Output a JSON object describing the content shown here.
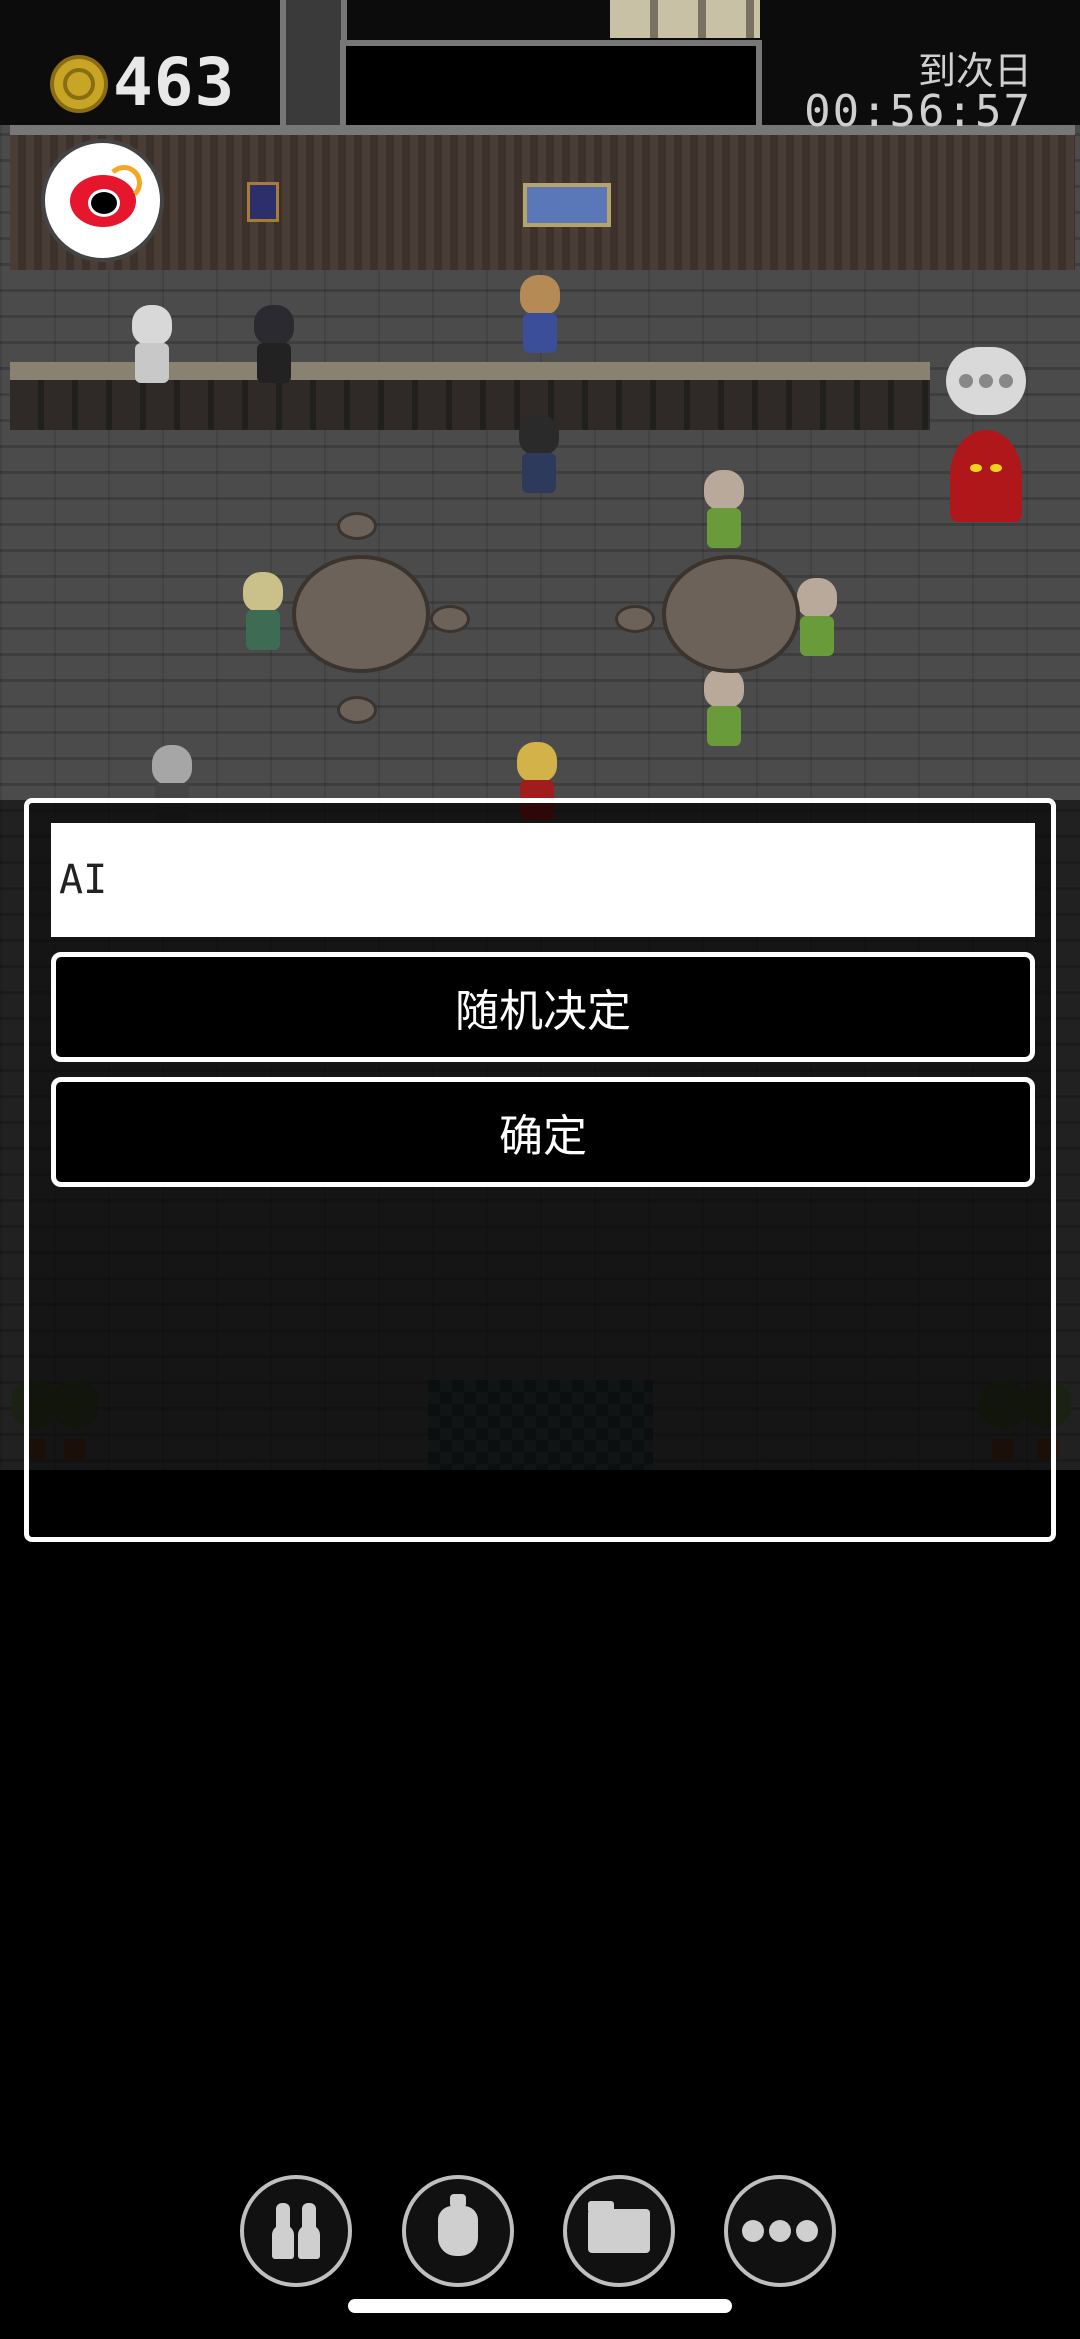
{
  "hud": {
    "coin_count": "463",
    "timer_label": "到次日",
    "timer": "00:56:57"
  },
  "icons": {
    "coin": "gold-coin-icon",
    "weibo": "weibo-icon",
    "chat": "chat-bubble-icon"
  },
  "dialog": {
    "name_value": "AI",
    "random_label": "随机决定",
    "confirm_label": "确定"
  },
  "bottom_bar": [
    {
      "icon": "people-icon"
    },
    {
      "icon": "bag-icon"
    },
    {
      "icon": "folder-icon"
    },
    {
      "icon": "more-icon"
    }
  ],
  "colors": {
    "floor": "#4b4b4b",
    "coin": "#c9a526",
    "weibo_red": "#e6162d",
    "dialog_border": "#ffffff"
  }
}
